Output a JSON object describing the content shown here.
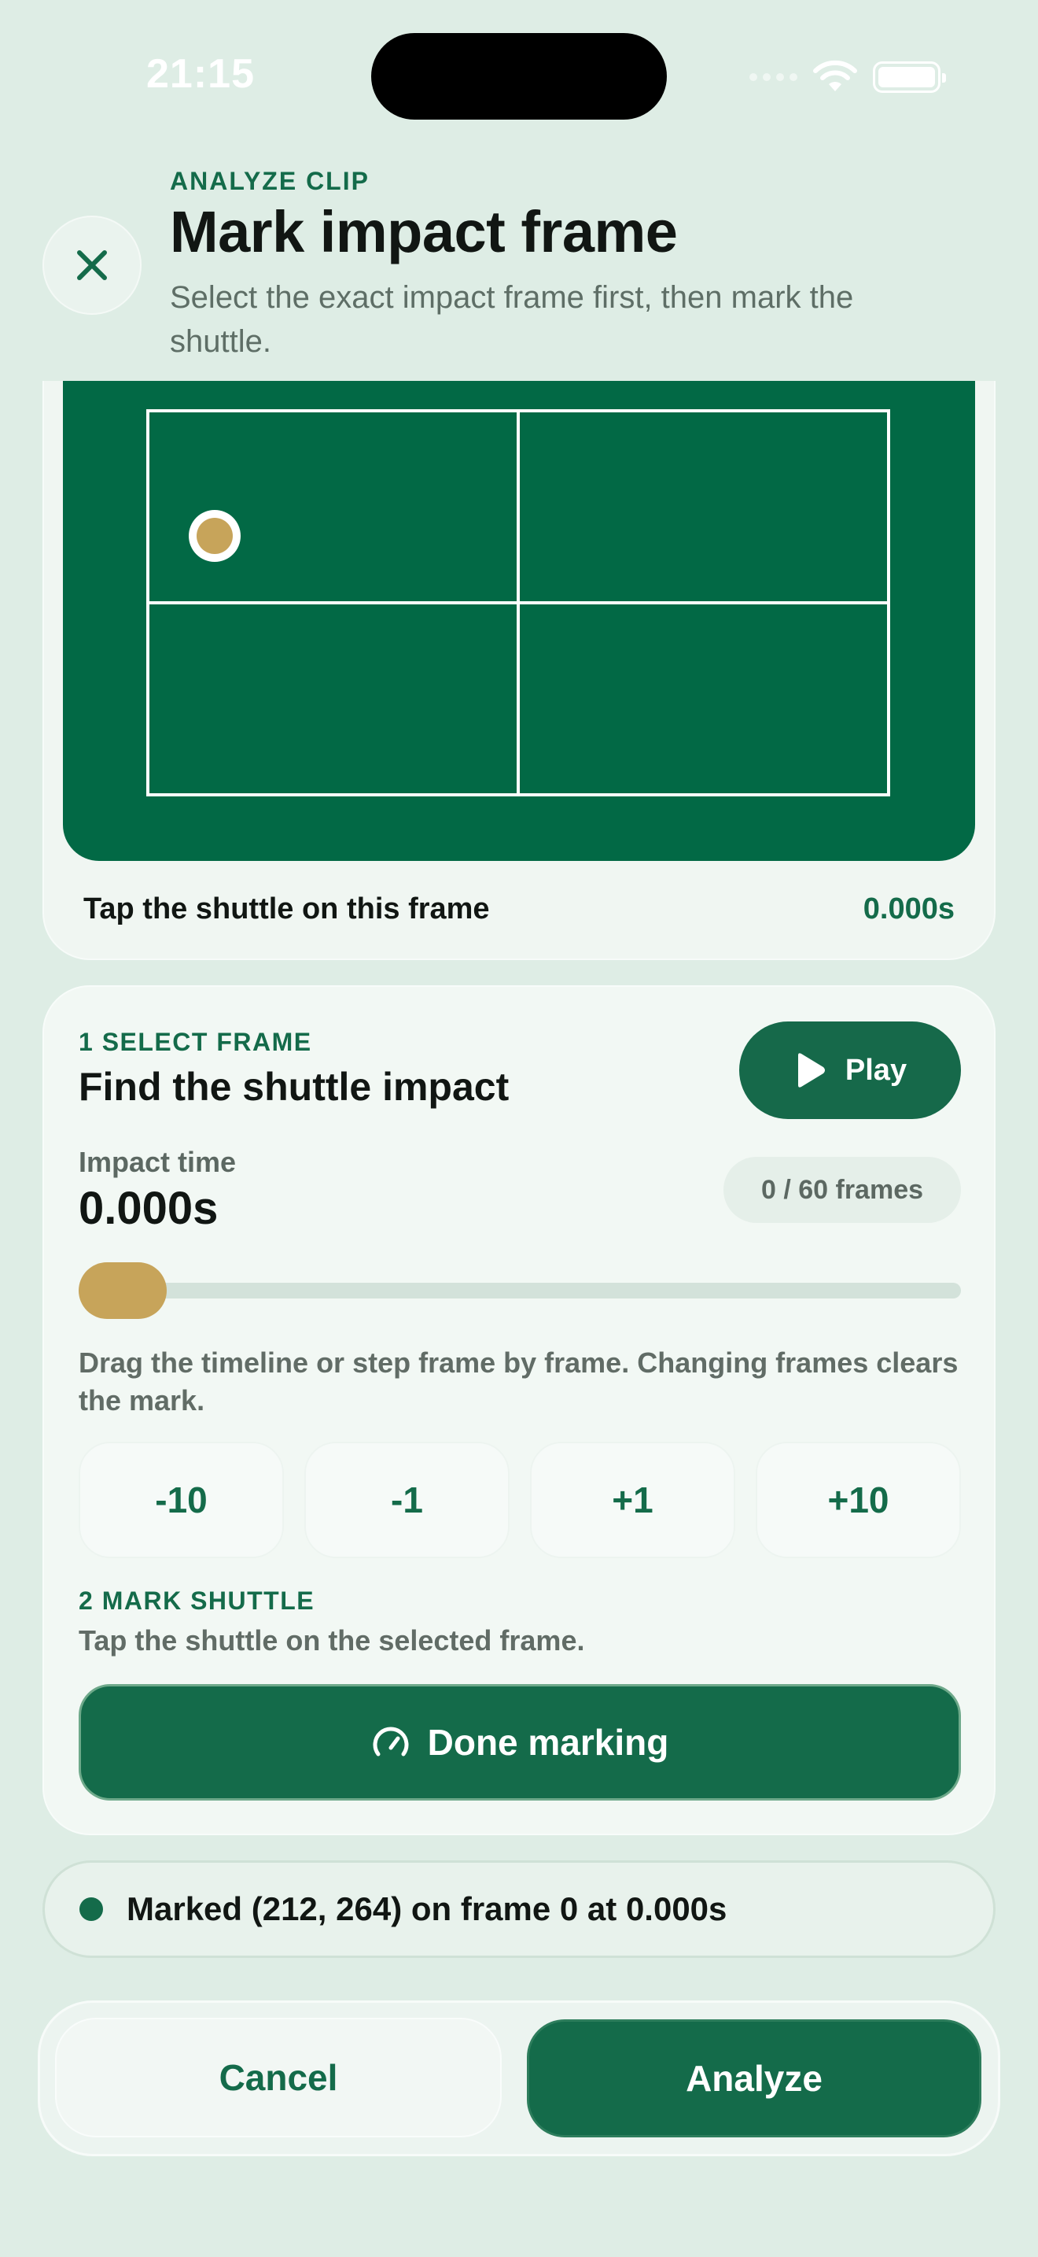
{
  "status_bar": {
    "time": "21:15",
    "icons": [
      "cellular-signal-icon",
      "wifi-icon",
      "battery-icon"
    ]
  },
  "header": {
    "close_icon": "close-icon",
    "eyebrow": "ANALYZE CLIP",
    "title": "Mark impact frame",
    "subtitle": "Select the exact impact frame first, then mark the shuttle."
  },
  "court_preview": {
    "tap_label": "Tap the shuttle on this frame",
    "time": "0.000s",
    "colors": {
      "court": "#026945",
      "lines": "#ffffff",
      "shuttle": "#c7a45a"
    }
  },
  "select_frame": {
    "step_label": "1 SELECT FRAME",
    "title": "Find the shuttle impact",
    "play_label": "Play",
    "play_icon": "play-icon",
    "impact_label": "Impact time",
    "impact_value": "0.000s",
    "frames_badge": "0 / 60 frames",
    "timeline_position": 0,
    "hint": "Drag the timeline or step frame by frame. Changing frames clears the mark.",
    "step_buttons": [
      "-10",
      "-1",
      "+1",
      "+10"
    ]
  },
  "mark_shuttle": {
    "step_label": "2 MARK SHUTTLE",
    "hint": "Tap the shuttle on the selected frame.",
    "done_label": "Done marking",
    "done_icon": "gauge-icon"
  },
  "marked_status": {
    "text": "Marked (212, 264) on frame 0 at 0.000s"
  },
  "bottom_bar": {
    "cancel_label": "Cancel",
    "analyze_label": "Analyze"
  },
  "colors": {
    "accent": "#146b4a",
    "background": "#deede5",
    "gold": "#c7a45a"
  }
}
